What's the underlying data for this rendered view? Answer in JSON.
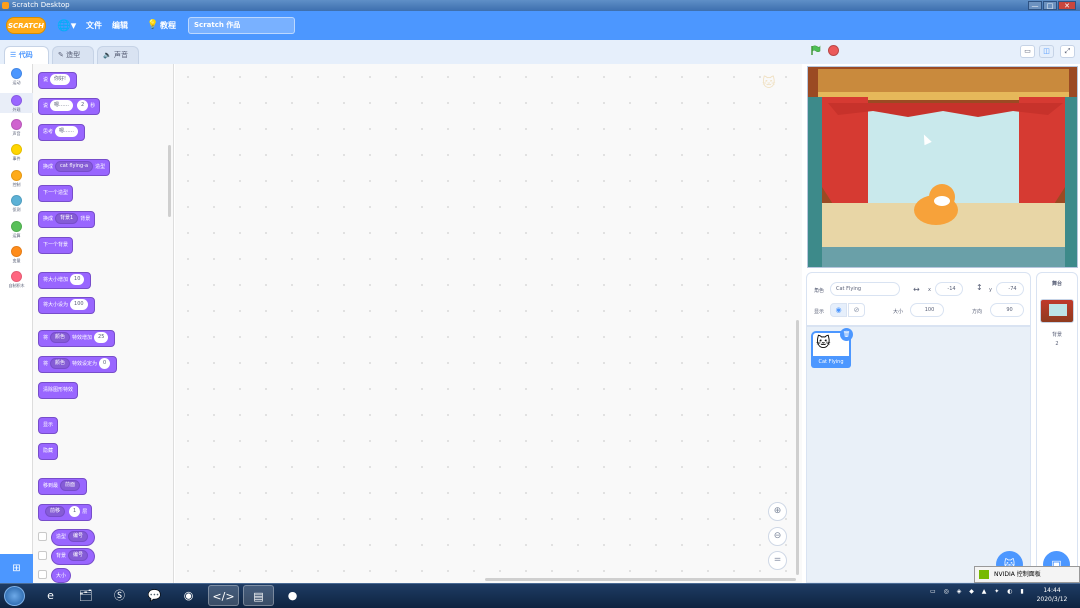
{
  "window": {
    "title": "Scratch Desktop",
    "controls": [
      "—",
      "□",
      "✕"
    ]
  },
  "menubar": {
    "logo": "SCRATCH",
    "language_icon": "globe-icon",
    "file": "文件",
    "edit": "编辑",
    "tutorials": "教程",
    "project_title": "Scratch 作品"
  },
  "tabs": {
    "code": "代码",
    "costumes": "造型",
    "sounds": "声音"
  },
  "categories": [
    {
      "label": "运动",
      "color": "#4c97ff"
    },
    {
      "label": "外观",
      "color": "#9966ff"
    },
    {
      "label": "声音",
      "color": "#cf63cf"
    },
    {
      "label": "事件",
      "color": "#ffd500"
    },
    {
      "label": "控制",
      "color": "#ffab19"
    },
    {
      "label": "侦测",
      "color": "#5cb1d6"
    },
    {
      "label": "运算",
      "color": "#59c059"
    },
    {
      "label": "变量",
      "color": "#ff8c1a"
    },
    {
      "label": "自制积木",
      "color": "#ff6680"
    }
  ],
  "blocks": {
    "say_prefix": "说",
    "say_value": "你好!",
    "say_secs_prefix": "说",
    "say_secs_value": "嗯……",
    "say_secs_num": "2",
    "say_secs_suffix": "秒",
    "think_prefix": "思考",
    "think_value": "嗯……",
    "switch_costume_prefix": "换成",
    "switch_costume_value": "cat flying-a",
    "switch_costume_suffix": "造型",
    "next_costume": "下一个造型",
    "switch_backdrop_prefix": "换成",
    "switch_backdrop_value": "背景1",
    "switch_backdrop_suffix": "背景",
    "next_backdrop": "下一个背景",
    "change_size_prefix": "将大小增加",
    "change_size_value": "10",
    "set_size_prefix": "将大小设为",
    "set_size_value": "100",
    "change_effect_prefix": "将",
    "change_effect_value": "颜色",
    "change_effect_mid": "特效增加",
    "change_effect_num": "25",
    "set_effect_prefix": "将",
    "set_effect_value": "颜色",
    "set_effect_mid": "特效设定为",
    "set_effect_num": "0",
    "clear_effects": "清除图形特效",
    "show": "显示",
    "hide": "隐藏",
    "go_to_layer_prefix": "移到最",
    "go_to_layer_value": "前面",
    "go_layers_prefix": "",
    "go_layers_value": "前移",
    "go_layers_num": "1",
    "go_layers_suffix": "层",
    "costume_number_prefix": "造型",
    "costume_number_value": "编号",
    "backdrop_number_prefix": "背景",
    "backdrop_number_value": "编号",
    "size": "大小"
  },
  "stage_controls": {
    "flag": "green-flag-icon",
    "stop": "stop-icon",
    "small": "▭",
    "normal": "◫",
    "full": "⤢"
  },
  "sprite_info": {
    "sprite_label": "角色",
    "sprite_name": "Cat Flying",
    "x_label": "x",
    "x_value": "-14",
    "y_label": "y",
    "y_value": "-74",
    "show_label": "显示",
    "size_label": "大小",
    "size_value": "100",
    "direction_label": "方向",
    "direction_value": "90"
  },
  "sprite_list": {
    "sprite_name": "Cat Flying"
  },
  "stage_panel": {
    "title": "舞台",
    "backdrop_label": "背景",
    "backdrop_count": "2"
  },
  "nvidia_popup": "NVIDIA 控制面板",
  "clock": {
    "time": "14:44",
    "date": "2020/3/12"
  }
}
